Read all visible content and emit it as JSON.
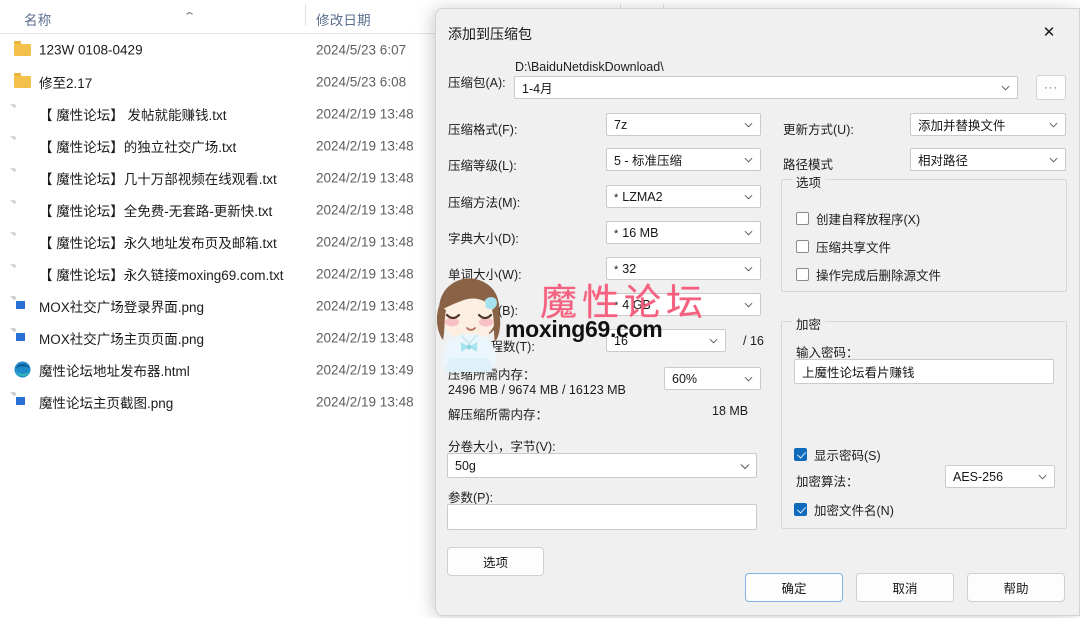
{
  "explorer": {
    "columns": [
      {
        "label": "名称",
        "sorted": true,
        "sort_dir": "asc"
      },
      {
        "label": "修改日期",
        "sorted": false
      }
    ],
    "files": [
      {
        "name": "123W 0108-0429",
        "date": "2024/5/23 6:07",
        "icon": "folder-icon"
      },
      {
        "name": "修至2.17",
        "date": "2024/5/23 6:08",
        "icon": "folder-icon"
      },
      {
        "name": "【 魔性论坛】 发帖就能赚钱.txt",
        "date": "2024/2/19 13:48",
        "icon": "text-file-icon"
      },
      {
        "name": "【 魔性论坛】的独立社交广场.txt",
        "date": "2024/2/19 13:48",
        "icon": "text-file-icon"
      },
      {
        "name": "【 魔性论坛】几十万部视频在线观看.txt",
        "date": "2024/2/19 13:48",
        "icon": "text-file-icon"
      },
      {
        "name": "【 魔性论坛】全免费-无套路-更新快.txt",
        "date": "2024/2/19 13:48",
        "icon": "text-file-icon"
      },
      {
        "name": "【 魔性论坛】永久地址发布页及邮箱.txt",
        "date": "2024/2/19 13:48",
        "icon": "text-file-icon"
      },
      {
        "name": "【 魔性论坛】永久链接moxing69.com.txt",
        "date": "2024/2/19 13:48",
        "icon": "text-file-icon"
      },
      {
        "name": "MOX社交广场登录界面.png",
        "date": "2024/2/19 13:48",
        "icon": "image-file-icon"
      },
      {
        "name": "MOX社交广场主页页面.png",
        "date": "2024/2/19 13:48",
        "icon": "image-file-icon"
      },
      {
        "name": "魔性论坛地址发布器.html",
        "date": "2024/2/19 13:49",
        "icon": "edge-browser-icon"
      },
      {
        "name": "魔性论坛主页截图.png",
        "date": "2024/2/19 13:48",
        "icon": "image-file-icon"
      }
    ]
  },
  "dialog": {
    "title": "添加到压缩包",
    "close_label": "✕",
    "archive": {
      "label": "压缩包(A):",
      "path": "D:\\BaiduNetdiskDownload\\",
      "name": "1-4月",
      "browse_label": "···"
    },
    "left_fields": [
      {
        "label": "压缩格式(F):",
        "value": "7z",
        "star": ""
      },
      {
        "label": "压缩等级(L):",
        "value": "5 - 标准压缩",
        "star": ""
      },
      {
        "label": "压缩方法(M):",
        "value": "LZMA2",
        "star": "*"
      },
      {
        "label": "字典大小(D):",
        "value": "16 MB",
        "star": "*"
      },
      {
        "label": "单词大小(W):",
        "value": "32",
        "star": "*"
      },
      {
        "label": "数据大小(B):",
        "value": "4 GB",
        "star": "*"
      }
    ],
    "cpu": {
      "label": "CPU 线程数(T):",
      "value": "16",
      "total": "/ 16"
    },
    "memory": {
      "compress_label": "压缩所需内存：",
      "compress_value": "2496 MB / 9674 MB / 16123 MB",
      "percent": "60%",
      "decompress_label": "解压缩所需内存：",
      "decompress_value": "18 MB"
    },
    "volume": {
      "label": "分卷大小，字节(V):",
      "value": "50g"
    },
    "params": {
      "label": "参数(P):",
      "value": ""
    },
    "options_button": "选项",
    "update_mode": {
      "label": "更新方式(U):",
      "value": "添加并替换文件"
    },
    "path_mode": {
      "label": "路径模式",
      "value": "相对路径"
    },
    "options_group": {
      "title": "选项",
      "items": [
        {
          "label": "创建自释放程序(X)",
          "checked": false
        },
        {
          "label": "压缩共享文件",
          "checked": false
        },
        {
          "label": "操作完成后删除源文件",
          "checked": false
        }
      ]
    },
    "encryption_group": {
      "title": "加密",
      "password_label": "输入密码：",
      "password_value": "上魔性论坛看片赚钱",
      "show_password": {
        "label": "显示密码(S)",
        "checked": true
      },
      "algorithm_label": "加密算法：",
      "algorithm_value": "AES-256",
      "encrypt_filenames": {
        "label": "加密文件名(N)",
        "checked": true
      }
    },
    "buttons": {
      "ok": "确定",
      "cancel": "取消",
      "help": "帮助"
    }
  },
  "watermark": {
    "brand": "魔性论坛",
    "url": "moxing69.com"
  },
  "colors": {
    "accent": "#0f6cbd",
    "header_text": "#5b6f90",
    "watermark_pink": "#f5607f",
    "folder": "#f3c14a"
  }
}
